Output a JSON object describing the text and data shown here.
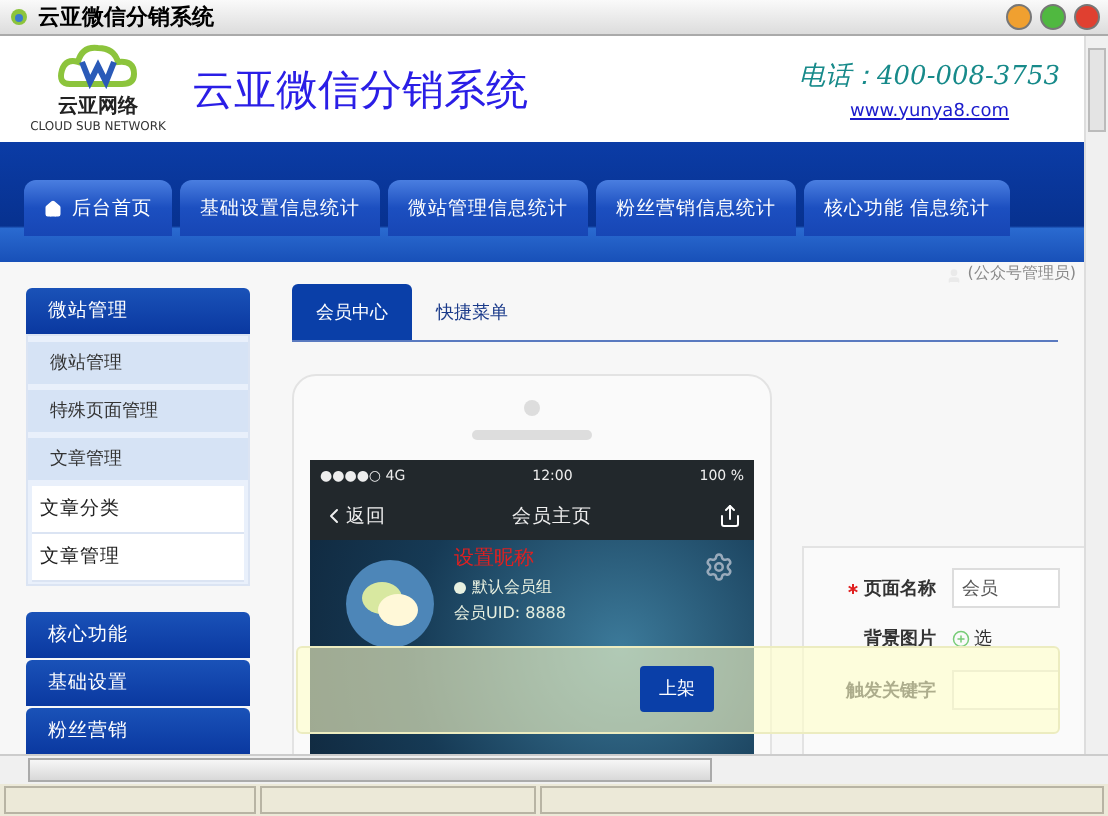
{
  "window": {
    "title": "云亚微信分销系统"
  },
  "header": {
    "logo_text": "云亚网络",
    "logo_subtext": "CLOUD SUB NETWORK",
    "title": "云亚微信分销系统",
    "phone": "电话：400-008-3753",
    "url": "www.yunya8.com"
  },
  "nav": [
    {
      "label": "后台首页",
      "kind": "home"
    },
    {
      "label": "基础设置信息统计",
      "kind": "plain"
    },
    {
      "label": "微站管理信息统计",
      "kind": "plain"
    },
    {
      "label": "粉丝营销信息统计",
      "kind": "plain"
    },
    {
      "label": "核心功能 信息统计",
      "kind": "plain"
    }
  ],
  "user_menu": {
    "label": "(公众号管理员)"
  },
  "sidebar": [
    {
      "label": "微站管理",
      "expanded": true,
      "items": [
        {
          "label": "微站管理",
          "kind": "section"
        },
        {
          "label": "特殊页面管理",
          "kind": "section"
        },
        {
          "label": "文章管理",
          "kind": "section"
        },
        {
          "label": "文章分类",
          "kind": "link"
        },
        {
          "label": "文章管理",
          "kind": "link"
        }
      ]
    },
    {
      "label": "核心功能",
      "expanded": false
    },
    {
      "label": "基础设置",
      "expanded": false
    },
    {
      "label": "粉丝营销",
      "expanded": false
    }
  ],
  "tabs": [
    {
      "label": "会员中心",
      "selected": true
    },
    {
      "label": "快捷菜单",
      "selected": false
    }
  ],
  "phone": {
    "signal": "●●●●○ 4G",
    "time": "12:00",
    "battery": "100 %",
    "back": "返回",
    "title": "会员主页",
    "nickname": "设置昵称",
    "group": "默认会员组",
    "uid": "会员UID: 8888"
  },
  "form": [
    {
      "label": "页面名称",
      "required": true,
      "kind": "input",
      "value": "会员"
    },
    {
      "label": "背景图片",
      "required": false,
      "kind": "upload",
      "value": "选"
    },
    {
      "label": "触发关键字",
      "required": false,
      "kind": "input"
    }
  ],
  "toast": {
    "button": "上架"
  }
}
